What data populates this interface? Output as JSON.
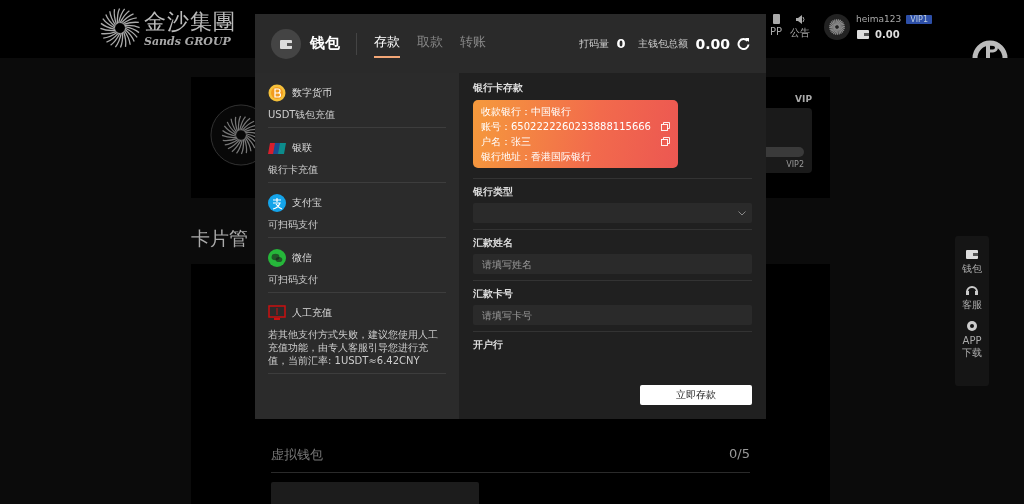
{
  "header": {
    "logo_cn": "金沙集團",
    "logo_en": "Sands GROUP",
    "nav": [
      {
        "kind": "app",
        "label": "PP"
      },
      {
        "kind": "notice",
        "label": "公告"
      }
    ],
    "user": {
      "name": "heima123",
      "vip": "VIP1",
      "balance": "0.00"
    }
  },
  "vip_card": {
    "link": "VIP",
    "next_level": "VIP2",
    "level": 0
  },
  "section_title": "卡片管",
  "virtual_wallet": {
    "title": "虚拟钱包",
    "count": "0/5"
  },
  "side_tools": [
    {
      "kind": "wallet",
      "label": "钱包"
    },
    {
      "kind": "service",
      "label": "客服"
    },
    {
      "kind": "app",
      "label": "APP 下载"
    }
  ],
  "modal": {
    "title": "钱包",
    "tabs": [
      {
        "label": "存款",
        "selected": true
      },
      {
        "label": "取款",
        "selected": false
      },
      {
        "label": "转账",
        "selected": false
      }
    ],
    "stats": [
      {
        "label": "打码量",
        "value": "0"
      },
      {
        "label": "主钱包总额",
        "value": "0.00"
      }
    ],
    "methods": [
      {
        "kind": "crypto",
        "name": "数字货币",
        "desc": "USDT钱包充值"
      },
      {
        "kind": "unionpay",
        "name": "银联",
        "desc": "银行卡充值"
      },
      {
        "kind": "alipay",
        "name": "支付宝",
        "desc": "可扫码支付"
      },
      {
        "kind": "wechat",
        "name": "微信",
        "desc": "可扫码支付"
      },
      {
        "kind": "manual",
        "name": "人工充值",
        "desc": "若其他支付方式失败，建议您使用人工充值功能，由专人客服引导您进行充值，当前汇率: 1USDT≈6.42CNY"
      }
    ],
    "form": {
      "section": "银行卡存款",
      "card_lines": [
        {
          "text": "收款银行：中国银行",
          "copyable": false
        },
        {
          "text": "账号：6502222260233888115666",
          "copyable": true
        },
        {
          "text": "户名：张三",
          "copyable": true
        },
        {
          "text": "银行地址：香港国际银行",
          "copyable": false
        }
      ],
      "fields": [
        {
          "kind": "select",
          "label": "银行类型"
        },
        {
          "kind": "input",
          "label": "汇款姓名",
          "placeholder": "请填写姓名"
        },
        {
          "kind": "input",
          "label": "汇款卡号",
          "placeholder": "请填写卡号"
        },
        {
          "kind": "text",
          "label": "开户行"
        }
      ],
      "submit": "立即存款"
    }
  }
}
